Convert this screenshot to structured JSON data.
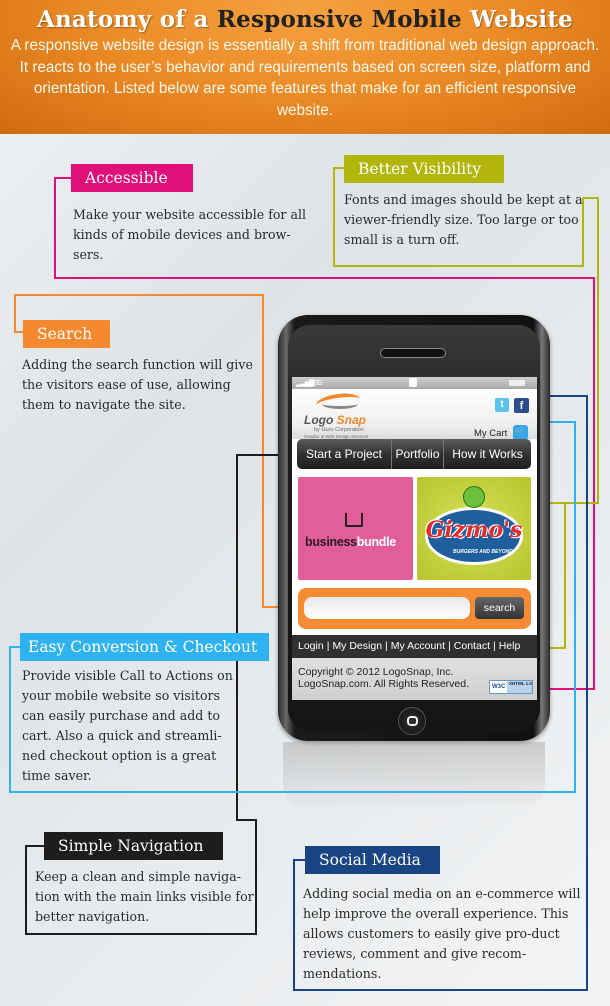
{
  "header": {
    "title_pre": "Anatomy of a ",
    "title_mid": "Responsive Mobile",
    "title_post": " Website",
    "intro": "A responsive website design is essentially a shift from traditional web design approach. It reacts to the user’s behavior and requirements based on screen size, platform and orientation. Listed below are some features that make for an efficient responsive website."
  },
  "features": {
    "accessible": {
      "label": "Accessible",
      "text": "Make your website accessible for all kinds of mobile devices and brow-sers.",
      "color": "#e0107a"
    },
    "visibility": {
      "label": "Better Visibility",
      "text": "Fonts and images should be kept at a viewer-friendly size. Too large or too small is a turn off.",
      "color": "#b2b60c"
    },
    "search": {
      "label": "Search",
      "text": "Adding the search function will give the visitors ease of use, allowing them to navigate the site.",
      "color": "#f5892f"
    },
    "checkout": {
      "label": "Easy Conversion & Checkout",
      "text": "Provide visible Call to Actions on your mobile website so visitors can easily purchase and add to cart. Also a quick and streamli-ned checkout option is a great time saver.",
      "color": "#2fb3f0"
    },
    "navigation": {
      "label": "Simple Navigation",
      "text": "Keep a clean and simple naviga-tion with the main links visible for better navigation.",
      "color": "#1d1d1d"
    },
    "social": {
      "label": "Social Media",
      "text": "Adding social media on an e-commerce will help improve the overall experience. This allows customers to easily give pro-duct reviews, comment and give recom-mendations.",
      "color": "#1a4584"
    }
  },
  "phone": {
    "status": {
      "signal": "▂▃▅▇ 3G"
    },
    "logo": {
      "word1": "Logo ",
      "word2": "Snap",
      "by": "by Guru Corporation",
      "tagline": "Graphic & Web Design Services"
    },
    "social_icons": {
      "twitter": "t",
      "facebook": "f"
    },
    "cart_label": "My Cart",
    "cart_icon": "🛒",
    "nav": [
      "Start a Project",
      "Portfolio",
      "How it Works"
    ],
    "tiles": {
      "tile1": {
        "word1": "business",
        "word2": "bundle"
      },
      "tile2": {
        "name": "Gizmo's",
        "tagline": "BURGERS AND BEYOND"
      }
    },
    "search": {
      "placeholder": "",
      "button": "search"
    },
    "footer_links": [
      "Login",
      "My Design",
      "My Account",
      "Contact",
      "Help"
    ],
    "copyright_1": "Copyright © 2012 LogoSnap, Inc.",
    "copyright_2": "LogoSnap.com. All Rights Reserved.",
    "badge": {
      "w3c": "W3C",
      "xhtml": "XHTML 1.0"
    }
  }
}
